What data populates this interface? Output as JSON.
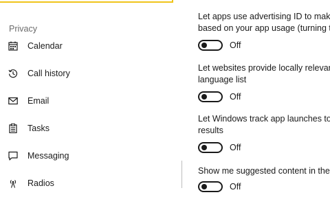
{
  "sidebar": {
    "section_title": "Privacy",
    "items": [
      {
        "label": "Calendar",
        "icon": "calendar-icon"
      },
      {
        "label": "Call history",
        "icon": "history-icon"
      },
      {
        "label": "Email",
        "icon": "mail-icon"
      },
      {
        "label": "Tasks",
        "icon": "tasks-icon"
      },
      {
        "label": "Messaging",
        "icon": "message-icon"
      },
      {
        "label": "Radios",
        "icon": "radio-icon"
      }
    ]
  },
  "settings": [
    {
      "line1": "Let apps use advertising ID to make",
      "line2": "based on your app usage (turning t",
      "state": "Off"
    },
    {
      "line1": "Let websites provide locally relevan",
      "line2": "language list",
      "state": "Off"
    },
    {
      "line1": "Let Windows track app launches to",
      "line2": "results",
      "state": "Off"
    },
    {
      "line1": "Show me suggested content in the",
      "line2": "",
      "state": "Off"
    }
  ],
  "colors": {
    "accent": "#f0c419",
    "text": "#1a1a1a",
    "muted": "#6b6b6b"
  }
}
